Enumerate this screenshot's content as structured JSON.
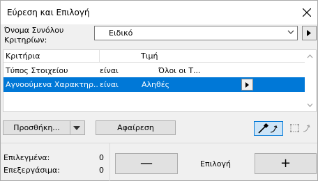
{
  "window": {
    "title": "Εύρεση και Επιλογή"
  },
  "criteria_set": {
    "label": "Όνομα Συνόλου Κριτηρίων:",
    "value": "Ειδικό"
  },
  "table": {
    "headers": {
      "criteria": "Κριτήρια",
      "value": "Τιμή"
    },
    "rows": [
      {
        "criterion": "Τύπος Στοιχείου",
        "operator": "είναι",
        "value": "Όλοι οι Τ..."
      },
      {
        "criterion": "Αγνοούμενα Χαρακτηρ...",
        "operator": "είναι",
        "value": "Αληθές",
        "selected": true
      }
    ]
  },
  "buttons": {
    "add": "Προσθήκη...",
    "remove": "Αφαίρεση",
    "deselect": "—",
    "select": "Επιλογή",
    "add_selection": "+"
  },
  "status": {
    "selected_label": "Επιλεγμένα:",
    "selected_count": "0",
    "editable_label": "Επεξεργάσιμα:",
    "editable_count": "0"
  },
  "colors": {
    "selection": "#0078d7",
    "active_tool_bg": "#cce4f7"
  },
  "icons": [
    "close-icon",
    "chevron-down-icon",
    "triangle-right-icon",
    "eyedropper-icon",
    "marquee-icon",
    "arrow-up-icon",
    "arrow-down-icon"
  ]
}
